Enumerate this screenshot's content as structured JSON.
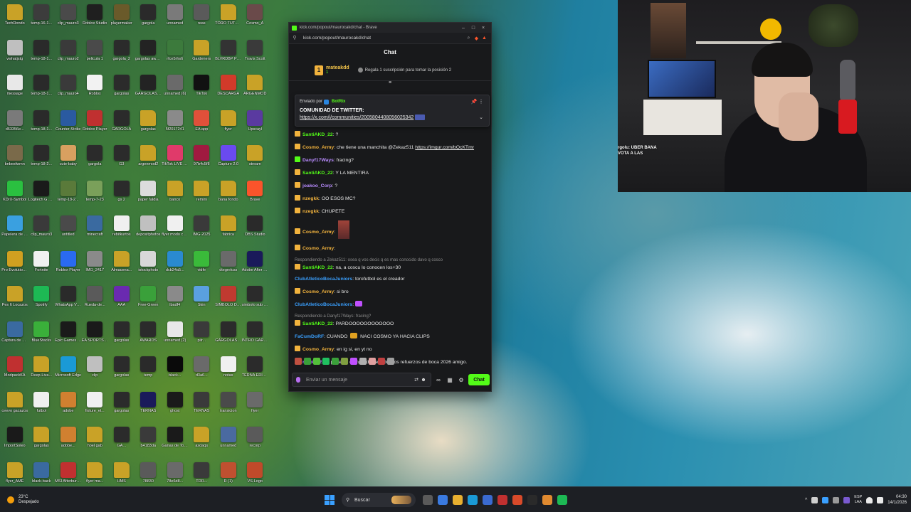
{
  "colors": {
    "kick_green": "#53fc18",
    "chat_bg": "#18191b",
    "taskbar_bg": "#1d1f24"
  },
  "desktop": {
    "icons": [
      {
        "label": "TechRondo",
        "icon": "folder-icon",
        "color": "#c9a227"
      },
      {
        "label": "temp-16-1...",
        "icon": "video-icon",
        "color": "#3c3c3c"
      },
      {
        "label": "clip_mauro3",
        "icon": "video-icon",
        "color": "#4a4a4a"
      },
      {
        "label": "Roblox Studio",
        "icon": "app-icon",
        "color": "#1f1f1f"
      },
      {
        "label": "playermaker",
        "icon": "app-icon",
        "color": "#6a5a2a"
      },
      {
        "label": "gargola",
        "icon": "gargoyle-icon",
        "color": "#2a2a2a"
      },
      {
        "label": "unnamed",
        "icon": "image-icon",
        "color": "#7a7a7a"
      },
      {
        "label": "reas",
        "icon": "image-icon",
        "color": "#5a5a5a"
      },
      {
        "label": "TORO TUTORIAL",
        "icon": "folder-icon",
        "color": "#c9a227"
      },
      {
        "label": "Cosmo_A",
        "icon": "image-icon",
        "color": "#6a4a4a"
      },
      {
        "label": "vwhatjstg",
        "icon": "image-icon",
        "color": "#bfbfbf"
      },
      {
        "label": "temp-18-1...",
        "icon": "video-icon",
        "color": "#2a2a2a"
      },
      {
        "label": "clip_mauro2",
        "icon": "video-icon",
        "color": "#3a3a3a"
      },
      {
        "label": "pelicula 1",
        "icon": "video-icon",
        "color": "#4a4a4a"
      },
      {
        "label": "gargola_2",
        "icon": "gargoyle-icon",
        "color": "#2b2b2b"
      },
      {
        "label": "gargolas awards",
        "icon": "gargoyle-icon",
        "color": "#232323"
      },
      {
        "label": "rfce5rhs6",
        "icon": "image-icon",
        "color": "#3c7a3c"
      },
      {
        "label": "Gardeners",
        "icon": "folder-icon",
        "color": "#c9a227"
      },
      {
        "label": "BLVRDBP PHONK",
        "icon": "image-icon",
        "color": "#333"
      },
      {
        "label": "Travis Scott",
        "icon": "image-icon",
        "color": "#3a3a3a"
      },
      {
        "label": "message",
        "icon": "doc-icon",
        "color": "#e8e8e8"
      },
      {
        "label": "temp-18-1...",
        "icon": "video-icon",
        "color": "#2a2a2a"
      },
      {
        "label": "clip_mauro4",
        "icon": "video-icon",
        "color": "#3a3a3a"
      },
      {
        "label": "Roblox",
        "icon": "roblox-icon",
        "color": "#f2f2f2"
      },
      {
        "label": "gargolas",
        "icon": "gargoyle-icon",
        "color": "#2b2b2b"
      },
      {
        "label": "GARGOLAS AWARDS",
        "icon": "gargoyle-icon",
        "color": "#232323"
      },
      {
        "label": "unnamed (6)",
        "icon": "image-icon",
        "color": "#6a6a6a"
      },
      {
        "label": "TikTok",
        "icon": "tiktok-icon",
        "color": "#111"
      },
      {
        "label": "DESCARGA",
        "icon": "pdf-icon",
        "color": "#d23a2a"
      },
      {
        "label": "ARGENMOD",
        "icon": "folder-icon",
        "color": "#c9a227"
      },
      {
        "label": "d63356e...",
        "icon": "image-icon",
        "color": "#7a7a7a"
      },
      {
        "label": "temp-18-1...",
        "icon": "video-icon",
        "color": "#2a2a2a"
      },
      {
        "label": "Counter-Strike",
        "icon": "cs-icon",
        "color": "#2a5aa0"
      },
      {
        "label": "Roblox Player",
        "icon": "roblox-icon",
        "color": "#c03030"
      },
      {
        "label": "GARGOLA",
        "icon": "gargoyle-icon",
        "color": "#2b2b2b"
      },
      {
        "label": "gargolas",
        "icon": "folder-icon",
        "color": "#c9a227"
      },
      {
        "label": "5f2017241",
        "icon": "image-icon",
        "color": "#8a8a8a"
      },
      {
        "label": "EA app",
        "icon": "ea-icon",
        "color": "#e0503a"
      },
      {
        "label": "flyer",
        "icon": "folder-icon",
        "color": "#c9a227"
      },
      {
        "label": "Upscayl",
        "icon": "app-icon",
        "color": "#5a3aa0"
      },
      {
        "label": "bnbesfwmn",
        "icon": "image-icon",
        "color": "#7a6a4a"
      },
      {
        "label": "temp-18-2...",
        "icon": "video-icon",
        "color": "#2a2a2a"
      },
      {
        "label": "cute-baby",
        "icon": "image-icon",
        "color": "#d8a060"
      },
      {
        "label": "gargola",
        "icon": "gargoyle-icon",
        "color": "#2b2b2b"
      },
      {
        "label": "G3",
        "icon": "gargoyle-icon",
        "color": "#2b2b2b"
      },
      {
        "label": "argenmod2",
        "icon": "folder-icon",
        "color": "#c9a227"
      },
      {
        "label": "TikTok LIVE Studio",
        "icon": "tiktok-icon",
        "color": "#e03a6a"
      },
      {
        "label": "97b4c5f8",
        "icon": "image-icon",
        "color": "#a01a40"
      },
      {
        "label": "Capture 2.0",
        "icon": "app-icon",
        "color": "#6a4af0"
      },
      {
        "label": "stream",
        "icon": "folder-icon",
        "color": "#c9a227"
      },
      {
        "label": "KDrX-Symbol",
        "icon": "app-icon",
        "color": "#2ac040"
      },
      {
        "label": "Logitech G HUB",
        "icon": "app-icon",
        "color": "#1a1a1a"
      },
      {
        "label": "temp-18-2...",
        "icon": "video-icon",
        "color": "#5a7a3a"
      },
      {
        "label": "temp-7-23",
        "icon": "image-icon",
        "color": "#7aa05a"
      },
      {
        "label": "gs 2",
        "icon": "gargoyle-icon",
        "color": "#2b2b2b"
      },
      {
        "label": "paper faldia",
        "icon": "image-icon",
        "color": "#dcdcdc"
      },
      {
        "label": "banco",
        "icon": "folder-icon",
        "color": "#c9a227"
      },
      {
        "label": "remini",
        "icon": "folder-icon",
        "color": "#c9a227"
      },
      {
        "label": "bana fondo",
        "icon": "folder-icon",
        "color": "#c9a227"
      },
      {
        "label": "Brave",
        "icon": "brave-icon",
        "color": "#fb542b"
      },
      {
        "label": "Papelera de reciclaje",
        "icon": "recycle-icon",
        "color": "#3aa0e0"
      },
      {
        "label": "clip_mauro3",
        "icon": "video-icon",
        "color": "#3a3a3a"
      },
      {
        "label": "untitled",
        "icon": "video-icon",
        "color": "#4a4a4a"
      },
      {
        "label": "minecraft",
        "icon": "image-icon",
        "color": "#3a6aa0"
      },
      {
        "label": "rebitkurtos",
        "icon": "doc-icon",
        "color": "#f0f0f0"
      },
      {
        "label": "depositphotos",
        "icon": "image-icon",
        "color": "#c0c0c0"
      },
      {
        "label": "flyer modo carrera",
        "icon": "doc-icon",
        "color": "#f0f0f0"
      },
      {
        "label": "IMG-2025",
        "icon": "image-icon",
        "color": "#3a3a3a"
      },
      {
        "label": "fabrica",
        "icon": "folder-icon",
        "color": "#c9a227"
      },
      {
        "label": "OBS Studio",
        "icon": "obs-icon",
        "color": "#2a2a2a"
      },
      {
        "label": "Pro Evolution Soccer 6",
        "icon": "game-icon",
        "color": "#d0a020"
      },
      {
        "label": "Fortnite",
        "icon": "doc-icon",
        "color": "#f0f0f0"
      },
      {
        "label": "Roblox Player",
        "icon": "roblox-icon",
        "color": "#2a6af0"
      },
      {
        "label": "IMG_2417",
        "icon": "image-icon",
        "color": "#8a8a8a"
      },
      {
        "label": "Almacena...",
        "icon": "folder-icon",
        "color": "#c9a227"
      },
      {
        "label": "istockphoto",
        "icon": "image-icon",
        "color": "#d8d8d8"
      },
      {
        "label": "dcb24a5...",
        "icon": "image-icon",
        "color": "#2a8ad0"
      },
      {
        "label": "vidfe",
        "icon": "app-icon",
        "color": "#3aba3a"
      },
      {
        "label": "dtegrelcss",
        "icon": "image-icon",
        "color": "#6a6a6a"
      },
      {
        "label": "Adobe After Effects",
        "icon": "ae-icon",
        "color": "#1a1a5a"
      },
      {
        "label": "Pes 6 Locazos",
        "icon": "folder-icon",
        "color": "#c9a227"
      },
      {
        "label": "Spotify",
        "icon": "spotify-icon",
        "color": "#1db954"
      },
      {
        "label": "WhatsApp Video 2025",
        "icon": "video-icon",
        "color": "#2a2a2a"
      },
      {
        "label": "Rueda-de...",
        "icon": "image-icon",
        "color": "#5a5a5a"
      },
      {
        "label": "AAA",
        "icon": "app-icon",
        "color": "#6a2ab0"
      },
      {
        "label": "Free-Green",
        "icon": "image-icon",
        "color": "#3aa03a"
      },
      {
        "label": "lbadf4",
        "icon": "image-icon",
        "color": "#8a8a8a"
      },
      {
        "label": "Skin",
        "icon": "image-icon",
        "color": "#5aa0e0"
      },
      {
        "label": "SIMBOLO DE SUB",
        "icon": "image-icon",
        "color": "#c03a30"
      },
      {
        "label": "simbolo sub pickle",
        "icon": "gargoyle-icon",
        "color": "#2b2b2b"
      },
      {
        "label": "Captura de pantalla",
        "icon": "image-icon",
        "color": "#3a6aa0"
      },
      {
        "label": "BlueStacks",
        "icon": "bluestacks-icon",
        "color": "#3ab03a"
      },
      {
        "label": "Epic Games Launcher",
        "icon": "epic-icon",
        "color": "#1a1a1a"
      },
      {
        "label": "EA SPORTS FC 26",
        "icon": "game-icon",
        "color": "#1a1a1a"
      },
      {
        "label": "gargolas",
        "icon": "gargoyle-icon",
        "color": "#2b2b2b"
      },
      {
        "label": "AWARDS",
        "icon": "gargoyle-icon",
        "color": "#2b2b2b"
      },
      {
        "label": "unnamed (2)",
        "icon": "image-icon",
        "color": "#e8e8e8"
      },
      {
        "label": "pilr...",
        "icon": "image-icon",
        "color": "#3a3a3a"
      },
      {
        "label": "GARGOLAS AWARDS",
        "icon": "gargoyle-icon",
        "color": "#2b2b2b"
      },
      {
        "label": "INTRO GARGOLAS",
        "icon": "gargoyle-icon",
        "color": "#2b2b2b"
      },
      {
        "label": "ModpackKA",
        "icon": "app-icon",
        "color": "#c03030"
      },
      {
        "label": "Deep-Liva...",
        "icon": "folder-icon",
        "color": "#c9a227"
      },
      {
        "label": "Microsoft Edge",
        "icon": "edge-icon",
        "color": "#1a9ad6"
      },
      {
        "label": "clip",
        "icon": "image-icon",
        "color": "#bfbfbf"
      },
      {
        "label": "gargolas",
        "icon": "gargoyle-icon",
        "color": "#2b2b2b"
      },
      {
        "label": "temp",
        "icon": "app-icon",
        "color": "#2a2a2a"
      },
      {
        "label": "black...",
        "icon": "image-icon",
        "color": "#0a0a0a"
      },
      {
        "label": "d3a6...",
        "icon": "image-icon",
        "color": "#6a6a6a"
      },
      {
        "label": "notas",
        "icon": "doc-icon",
        "color": "#f0f0f0"
      },
      {
        "label": "TERNA EDITORIAL",
        "icon": "image-icon",
        "color": "#2b2b2b"
      },
      {
        "label": "ceevo gacazos",
        "icon": "folder-icon",
        "color": "#c9a227"
      },
      {
        "label": "futbol",
        "icon": "doc-icon",
        "color": "#f0f0f0"
      },
      {
        "label": "adobe",
        "icon": "app-icon",
        "color": "#d08030"
      },
      {
        "label": "fixture_el...",
        "icon": "doc-icon",
        "color": "#f0f0f0"
      },
      {
        "label": "gargolas",
        "icon": "gargoyle-icon",
        "color": "#2b2b2b"
      },
      {
        "label": "TERNAS",
        "icon": "ae-icon",
        "color": "#1a1a5a"
      },
      {
        "label": "ghost",
        "icon": "image-icon",
        "color": "#1a1a1a"
      },
      {
        "label": "TERNAS",
        "icon": "image-icon",
        "color": "#3a3a3a"
      },
      {
        "label": "transicion",
        "icon": "image-icon",
        "color": "#4a4a4a"
      },
      {
        "label": "flyer",
        "icon": "image-icon",
        "color": "#6a6a6a"
      },
      {
        "label": "ImportSoleo",
        "icon": "app-icon",
        "color": "#1a1a1a"
      },
      {
        "label": "gargolas",
        "icon": "folder-icon",
        "color": "#c9a227"
      },
      {
        "label": "adobe...",
        "icon": "app-icon",
        "color": "#d08030"
      },
      {
        "label": "hoel gab",
        "icon": "folder-icon",
        "color": "#c9a227"
      },
      {
        "label": "GA...",
        "icon": "gargoyle-icon",
        "color": "#2b2b2b"
      },
      {
        "label": "b4183da",
        "icon": "image-icon",
        "color": "#3a3a3a"
      },
      {
        "label": "Ganas de Touge",
        "icon": "app-icon",
        "color": "#1a1a1a"
      },
      {
        "label": "asdaqs",
        "icon": "folder-icon",
        "color": "#c9a227"
      },
      {
        "label": "unnamed",
        "icon": "image-icon",
        "color": "#4a6aa0"
      },
      {
        "label": "recorp",
        "icon": "image-icon",
        "color": "#5a5a5a"
      },
      {
        "label": "flyer_AME",
        "icon": "folder-icon",
        "color": "#c9a227"
      },
      {
        "label": "black-back",
        "icon": "image-icon",
        "color": "#3a6aa0"
      },
      {
        "label": "MSI Afterburner",
        "icon": "app-icon",
        "color": "#c03030"
      },
      {
        "label": "flyer ma...",
        "icon": "folder-icon",
        "color": "#c9a227"
      },
      {
        "label": "HMS",
        "icon": "folder-icon",
        "color": "#c9a227"
      },
      {
        "label": "78830",
        "icon": "image-icon",
        "color": "#5a5a5a"
      },
      {
        "label": "78e6d8...",
        "icon": "image-icon",
        "color": "#6a6a6a"
      },
      {
        "label": "TDR...",
        "icon": "image-icon",
        "color": "#3a3a3a"
      },
      {
        "label": "R (1)",
        "icon": "image-icon",
        "color": "#c05030"
      },
      {
        "label": "VS-Logo",
        "icon": "image-icon",
        "color": "#c04a2a"
      }
    ]
  },
  "browser": {
    "title": "kick.com/popout/maurocakd/chat - Brave",
    "url": "kick.com/popout/maurocakd/chat",
    "chat_title": "Chat",
    "gift": {
      "rank": "1",
      "user": "mateakdd",
      "count": "1",
      "message": "Regala 1 suscripción para tomar la posición 2"
    },
    "pinned": {
      "sent_by": "Enviado por",
      "bot_name": "BotRix",
      "title": "COMUNIDAD DE TWITTER:",
      "link": "https://x.com/i/communities/2005804408056025342"
    },
    "messages": [
      {
        "user": "SantiAKD_22",
        "color": "#53fc18",
        "text": ": ?",
        "badge": "#f2b33d"
      },
      {
        "user": "Cosmo_Army",
        "color": "#f2b33d",
        "text": ": che tiene una manchita @Zekaz511 ",
        "link": "https://imgur.com/bQcKTmr",
        "badge": "#f2b33d"
      },
      {
        "user": "Danyf17Ways",
        "color": "#b98cff",
        "text": ": fracing?",
        "badge": "#53fc18"
      },
      {
        "user": "SantiAKD_22",
        "color": "#53fc18",
        "text": ": Y LA MENTIRA",
        "badge": "#f2b33d"
      },
      {
        "user": "joakoo_Corp",
        "color": "#b98cff",
        "text": ": ?",
        "badge": "#f2b33d"
      },
      {
        "user": "nzegkk",
        "color": "#f2b33d",
        "text": ": OO ESOS MC?",
        "badge": "#f2b33d"
      },
      {
        "user": "nzegkk",
        "color": "#f2b33d",
        "text": ": CHUPETE",
        "badge": "#f2b33d"
      },
      {
        "user": "Cosmo_Army",
        "color": "#f2b33d",
        "text": ":",
        "badge": "#f2b33d",
        "emote": true
      },
      {
        "user": "Cosmo_Army",
        "color": "#f2b33d",
        "text": ":",
        "badge": "#f2b33d"
      },
      {
        "reply": "Respondiendo a Zekaz511: osea q vos decis q es mas conocido davo q cosco",
        "user": "SantiAKD_22",
        "color": "#53fc18",
        "text": ": na, a coscu lo conocen los+30",
        "badge": "#f2b33d"
      },
      {
        "user": "ClubAtleticoBocaJuniors",
        "color": "#3aa0ff",
        "text": ": torofutbol es el creador"
      },
      {
        "user": "Cosmo_Army",
        "color": "#f2b33d",
        "text": ": si bro",
        "badge": "#f2b33d"
      },
      {
        "user": "ClubAtleticoBocaJuniors",
        "color": "#3aa0ff",
        "text": ":",
        "inline_emote": "#c050ff"
      },
      {
        "reply": "Respondiendo a Danyf17Ways: fracing?",
        "user": "SantiAKD_22",
        "color": "#53fc18",
        "text": ": PARDOOOOOOOOOOOO",
        "badge": "#f2b33d"
      },
      {
        "user": "FaCumDoRF",
        "color": "#3aa0ff",
        "text": ": CUANDO ",
        "after": " NACI COSMO YA HACIA CLIPS",
        "inline_emote": "#e0a020"
      },
      {
        "user": "Cosmo_Army",
        "color": "#f2b33d",
        "text": ": en ig si, en yt no",
        "badge": "#f2b33d"
      },
      {
        "user": "nicolas23N",
        "color": "#b98cff",
        "text": ": pone un compilado de todos los refuerzos de boca 2026 amigo.",
        "badge": "#f2b33d"
      }
    ],
    "emote_colors": [
      "#c05040",
      "#3aa03a",
      "#53c03a",
      "#20c060",
      "#3aa03a",
      "#80a040",
      "#c050ff",
      "#b0b0b0",
      "#e0a0a0",
      "#c04040",
      "#a0a0a0"
    ],
    "input_placeholder": "Enviar un mensaje",
    "send_label": "Chat"
  },
  "webcam": {
    "overlay_lines": [
      "rgolu: UBER BANA",
      "VOTA A LAS"
    ]
  },
  "taskbar": {
    "temperature": "23°C",
    "weather": "Despejado",
    "search_label": "Buscar",
    "lang_top": "ESP",
    "lang_bottom": "LAA",
    "time": "04:30",
    "date": "14/1/2026",
    "apps": [
      "#5a5a5a",
      "#3a7ae0",
      "#e8b030",
      "#1a9ad6",
      "#3a6ad0",
      "#c03030",
      "#d84a2a",
      "#2a2a2a",
      "#e08a30",
      "#1db954"
    ]
  }
}
